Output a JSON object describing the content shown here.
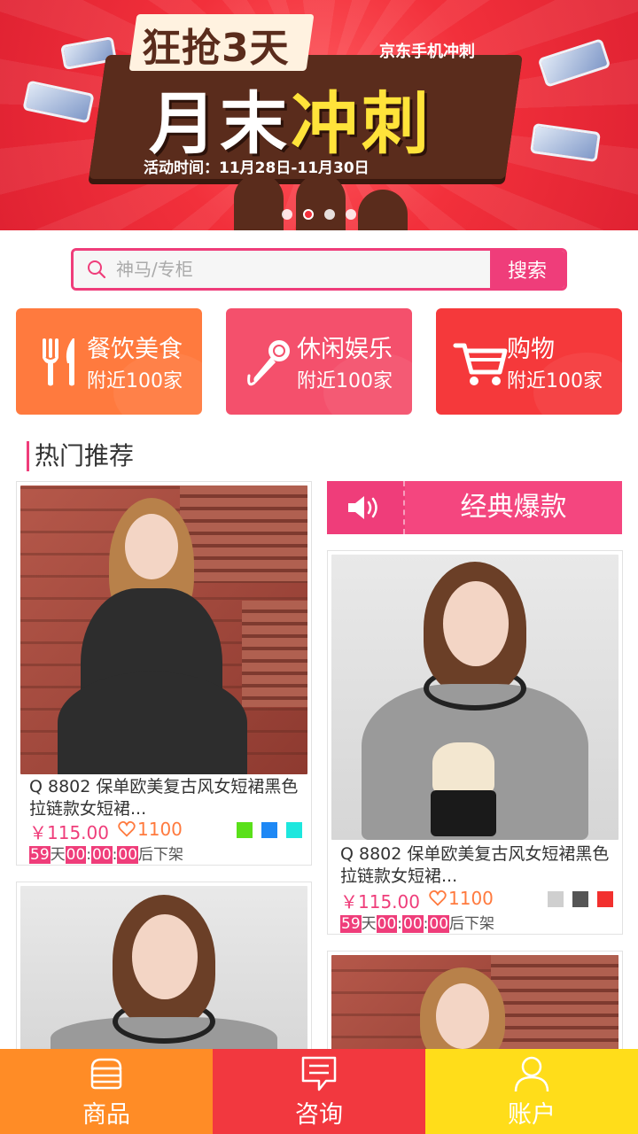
{
  "banner": {
    "top_text": "狂抢3天",
    "brand": "京东手机冲刺",
    "main_text_white": "月末",
    "main_text_yellow": "冲刺",
    "date_line": "活动时间：11月28日-11月30日"
  },
  "search": {
    "placeholder": "神马/专柜",
    "button_label": "搜索"
  },
  "categories": [
    {
      "name": "餐饮美食",
      "sub": "附近100家",
      "icon": "fork-knife-icon",
      "color": "#ff7a3e"
    },
    {
      "name": "休闲娱乐",
      "sub": "附近100家",
      "icon": "microphone-icon",
      "color": "#f4506c"
    },
    {
      "name": "购物",
      "sub": "附近100家",
      "icon": "cart-icon",
      "color": "#f5393b"
    }
  ],
  "section_title": "热门推荐",
  "classic": {
    "label": "经典爆款",
    "icon": "speaker-icon"
  },
  "products": [
    {
      "title": "Q 8802 保单欧美复古风女短裙黑色拉链款女短裙...",
      "price": "￥115.00",
      "likes": "1100",
      "swatches": [
        "#5ae01a",
        "#1e88f5",
        "#1de7de"
      ],
      "countdown": {
        "days": "59",
        "d_label": "天",
        "h": "00",
        "m": "00",
        "s": "00",
        "sep": ":",
        "suffix": "后下架"
      }
    },
    {
      "title": "Q 8802 保单欧美复古风女短裙黑色拉链款女短裙...",
      "price": "￥115.00",
      "likes": "1100",
      "swatches": [
        "#cfcfcf",
        "#555555",
        "#f2302e"
      ],
      "countdown": {
        "days": "59",
        "d_label": "天",
        "h": "00",
        "m": "00",
        "s": "00",
        "sep": ":",
        "suffix": "后下架"
      }
    }
  ],
  "nav": [
    {
      "label": "商品",
      "icon": "store-icon",
      "color": "#ff8c26"
    },
    {
      "label": "咨询",
      "icon": "chat-icon",
      "color": "#f2383f"
    },
    {
      "label": "账户",
      "icon": "user-icon",
      "color": "#ffdd1a"
    }
  ],
  "colors": {
    "accent": "#ef3d7a",
    "price": "#ef3d7a",
    "likes": "#ff7a3e"
  }
}
